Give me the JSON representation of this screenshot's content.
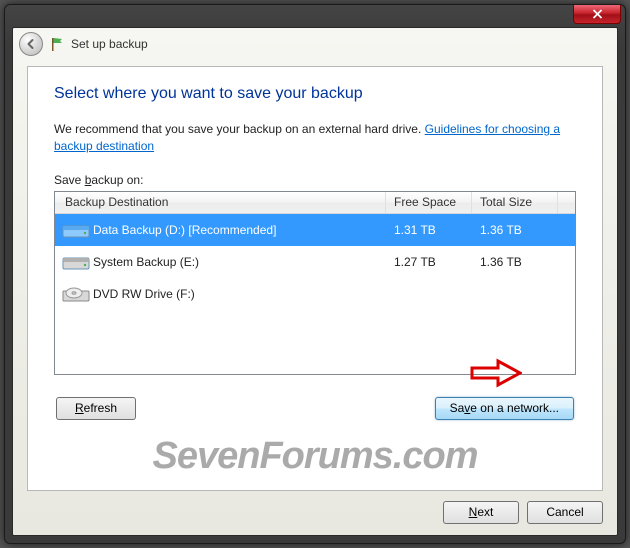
{
  "header": {
    "title": "Set up backup"
  },
  "main": {
    "heading": "Select where you want to save your backup",
    "recommend_prefix": "We recommend that you save your backup on an external hard drive. ",
    "guidelines_link": "Guidelines for choosing a backup destination",
    "save_label_pre": "Save ",
    "save_label_ul": "b",
    "save_label_post": "ackup on:",
    "columns": {
      "destination": "Backup Destination",
      "free": "Free Space",
      "total": "Total Size"
    },
    "rows": [
      {
        "name": "Data Backup (D:) [Recommended]",
        "free": "1.31 TB",
        "total": "1.36 TB",
        "selected": true,
        "icon": "hdd"
      },
      {
        "name": "System Backup (E:)",
        "free": "1.27 TB",
        "total": "1.36 TB",
        "selected": false,
        "icon": "hdd"
      },
      {
        "name": "DVD RW Drive (F:)",
        "free": "",
        "total": "",
        "selected": false,
        "icon": "dvd"
      }
    ],
    "refresh_pre": "",
    "refresh_ul": "R",
    "refresh_post": "efresh",
    "network_pre": "Sa",
    "network_ul": "v",
    "network_post": "e on a network..."
  },
  "footer": {
    "next_ul": "N",
    "next_post": "ext",
    "cancel": "Cancel"
  },
  "watermark": "SevenForums.com"
}
